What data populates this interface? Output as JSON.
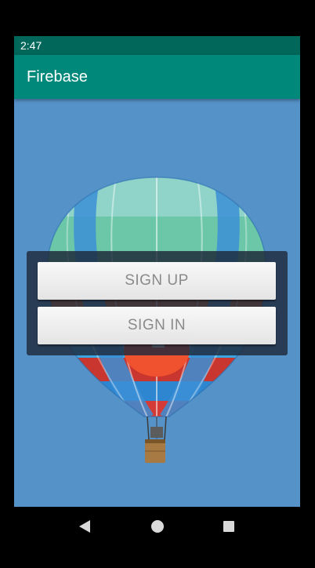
{
  "status_bar": {
    "time": "2:47"
  },
  "app_bar": {
    "title": "Firebase"
  },
  "auth": {
    "sign_up_label": "SIGN UP",
    "sign_in_label": "SIGN IN"
  },
  "navigation": {
    "back_icon": "triangle-back-icon",
    "home_icon": "circle-home-icon",
    "recents_icon": "square-recents-icon"
  },
  "colors": {
    "status_bar": "#00675a",
    "app_bar": "#00897b",
    "background_sky": "#5592c8",
    "button_text": "#8a8a8a"
  }
}
